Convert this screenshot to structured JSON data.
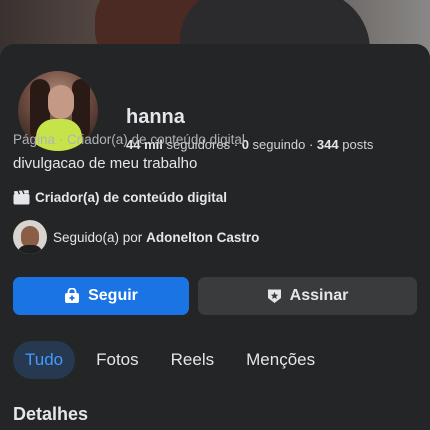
{
  "profile": {
    "name": "hanna",
    "followers_count": "44 mil",
    "followers_label": "seguidores",
    "following_count": "0",
    "following_label": "seguindo",
    "posts_count": "344",
    "posts_label": "posts",
    "separator": "·",
    "category_line": "Página · Criador(a) de conteúdo digital",
    "bio": "divulgacao de meu trabalho",
    "creator_badge": "Criador(a) de conteúdo digital",
    "followed_by_prefix": "Seguido(a) por",
    "followed_by_name": "Adonelton Castro"
  },
  "actions": {
    "follow_label": "Seguir",
    "subscribe_label": "Assinar"
  },
  "tabs": [
    {
      "label": "Tudo",
      "active": true
    },
    {
      "label": "Fotos",
      "active": false
    },
    {
      "label": "Reels",
      "active": false
    },
    {
      "label": "Menções",
      "active": false
    }
  ],
  "sections": {
    "details_title": "Detalhes"
  },
  "colors": {
    "accent": "#1b74e4",
    "active_tab_bg": "#263951",
    "active_tab_text": "#4599ff",
    "panel_bg": "#242526"
  },
  "icons": {
    "follow": "user-plus-icon",
    "subscribe": "shield-badge-icon",
    "creator": "clapperboard-icon"
  }
}
